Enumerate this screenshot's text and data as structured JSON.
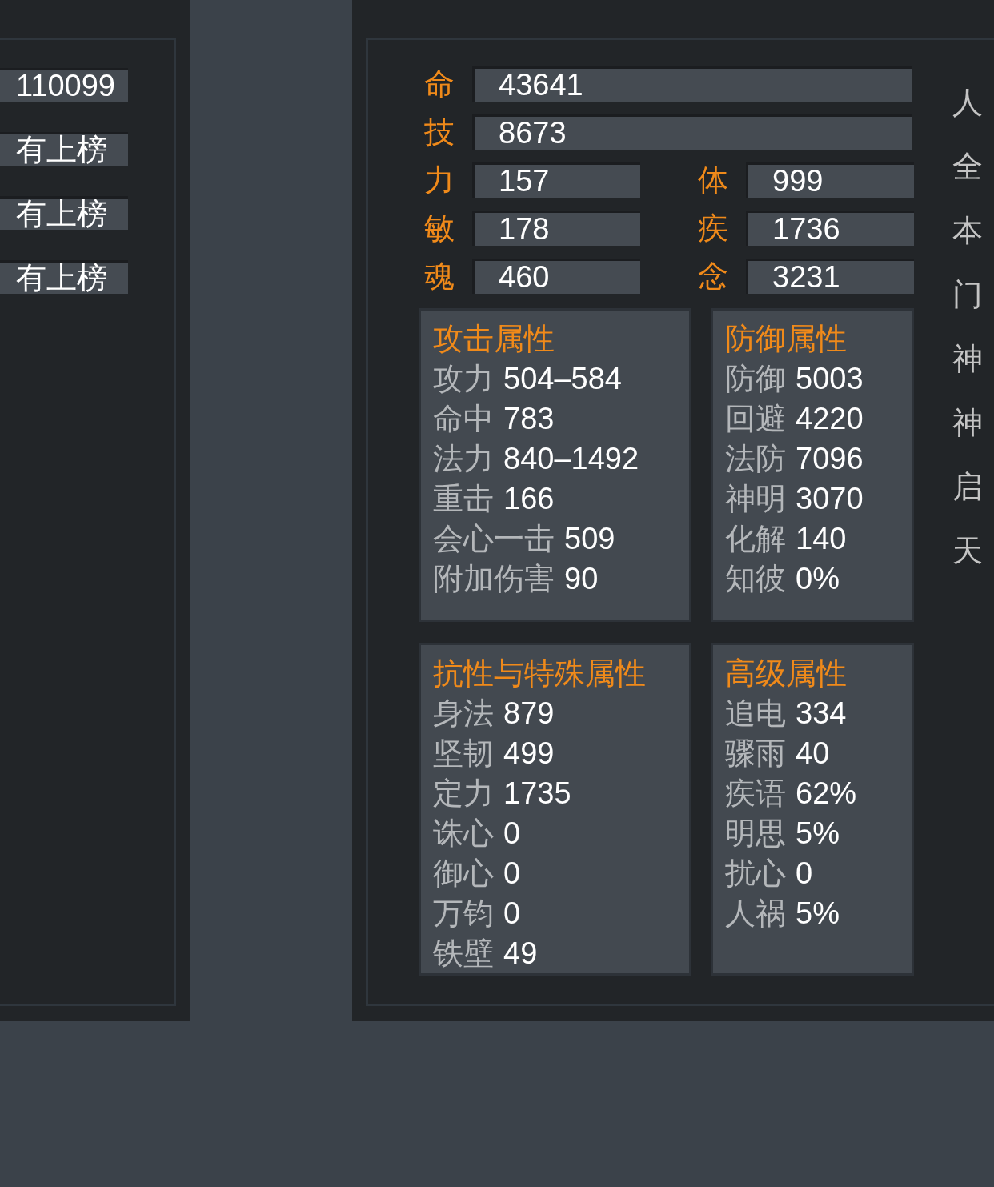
{
  "left_panel": {
    "fields": [
      "110099",
      "有上榜",
      "有上榜",
      "有上榜"
    ]
  },
  "vitals": [
    {
      "label": "命",
      "value": "43641"
    },
    {
      "label": "技",
      "value": "8673"
    }
  ],
  "attributes": [
    {
      "label": "力",
      "value": "157"
    },
    {
      "label": "体",
      "value": "999"
    },
    {
      "label": "敏",
      "value": "178"
    },
    {
      "label": "疾",
      "value": "1736"
    },
    {
      "label": "魂",
      "value": "460"
    },
    {
      "label": "念",
      "value": "3231"
    }
  ],
  "cards": [
    {
      "title": "攻击属性",
      "rows": [
        {
          "label": "攻力",
          "value": "504–584"
        },
        {
          "label": "命中",
          "value": "783"
        },
        {
          "label": "法力",
          "value": "840–1492"
        },
        {
          "label": "重击",
          "value": "166"
        },
        {
          "label": "会心一击",
          "value": "509"
        },
        {
          "label": "附加伤害",
          "value": "90"
        }
      ]
    },
    {
      "title": "防御属性",
      "rows": [
        {
          "label": "防御",
          "value": "5003"
        },
        {
          "label": "回避",
          "value": "4220"
        },
        {
          "label": "法防",
          "value": "7096"
        },
        {
          "label": "神明",
          "value": "3070"
        },
        {
          "label": "化解",
          "value": "140"
        },
        {
          "label": "知彼",
          "value": "0%"
        }
      ]
    },
    {
      "title": "抗性与特殊属性",
      "rows": [
        {
          "label": "身法",
          "value": "879"
        },
        {
          "label": "坚韧",
          "value": "499"
        },
        {
          "label": "定力",
          "value": "1735"
        },
        {
          "label": "诛心",
          "value": "0"
        },
        {
          "label": "御心",
          "value": "0"
        },
        {
          "label": "万钧",
          "value": "0"
        },
        {
          "label": "铁壁",
          "value": "49"
        }
      ]
    },
    {
      "title": "高级属性",
      "rows": [
        {
          "label": "追电",
          "value": "334"
        },
        {
          "label": "骤雨",
          "value": "40"
        },
        {
          "label": "疾语",
          "value": "62%"
        },
        {
          "label": "明思",
          "value": "5%"
        },
        {
          "label": "扰心",
          "value": "0"
        },
        {
          "label": "人祸",
          "value": "5%"
        }
      ]
    }
  ],
  "side_menu": [
    "人",
    "全",
    "本",
    "门",
    "神",
    "神",
    "启",
    "天"
  ]
}
